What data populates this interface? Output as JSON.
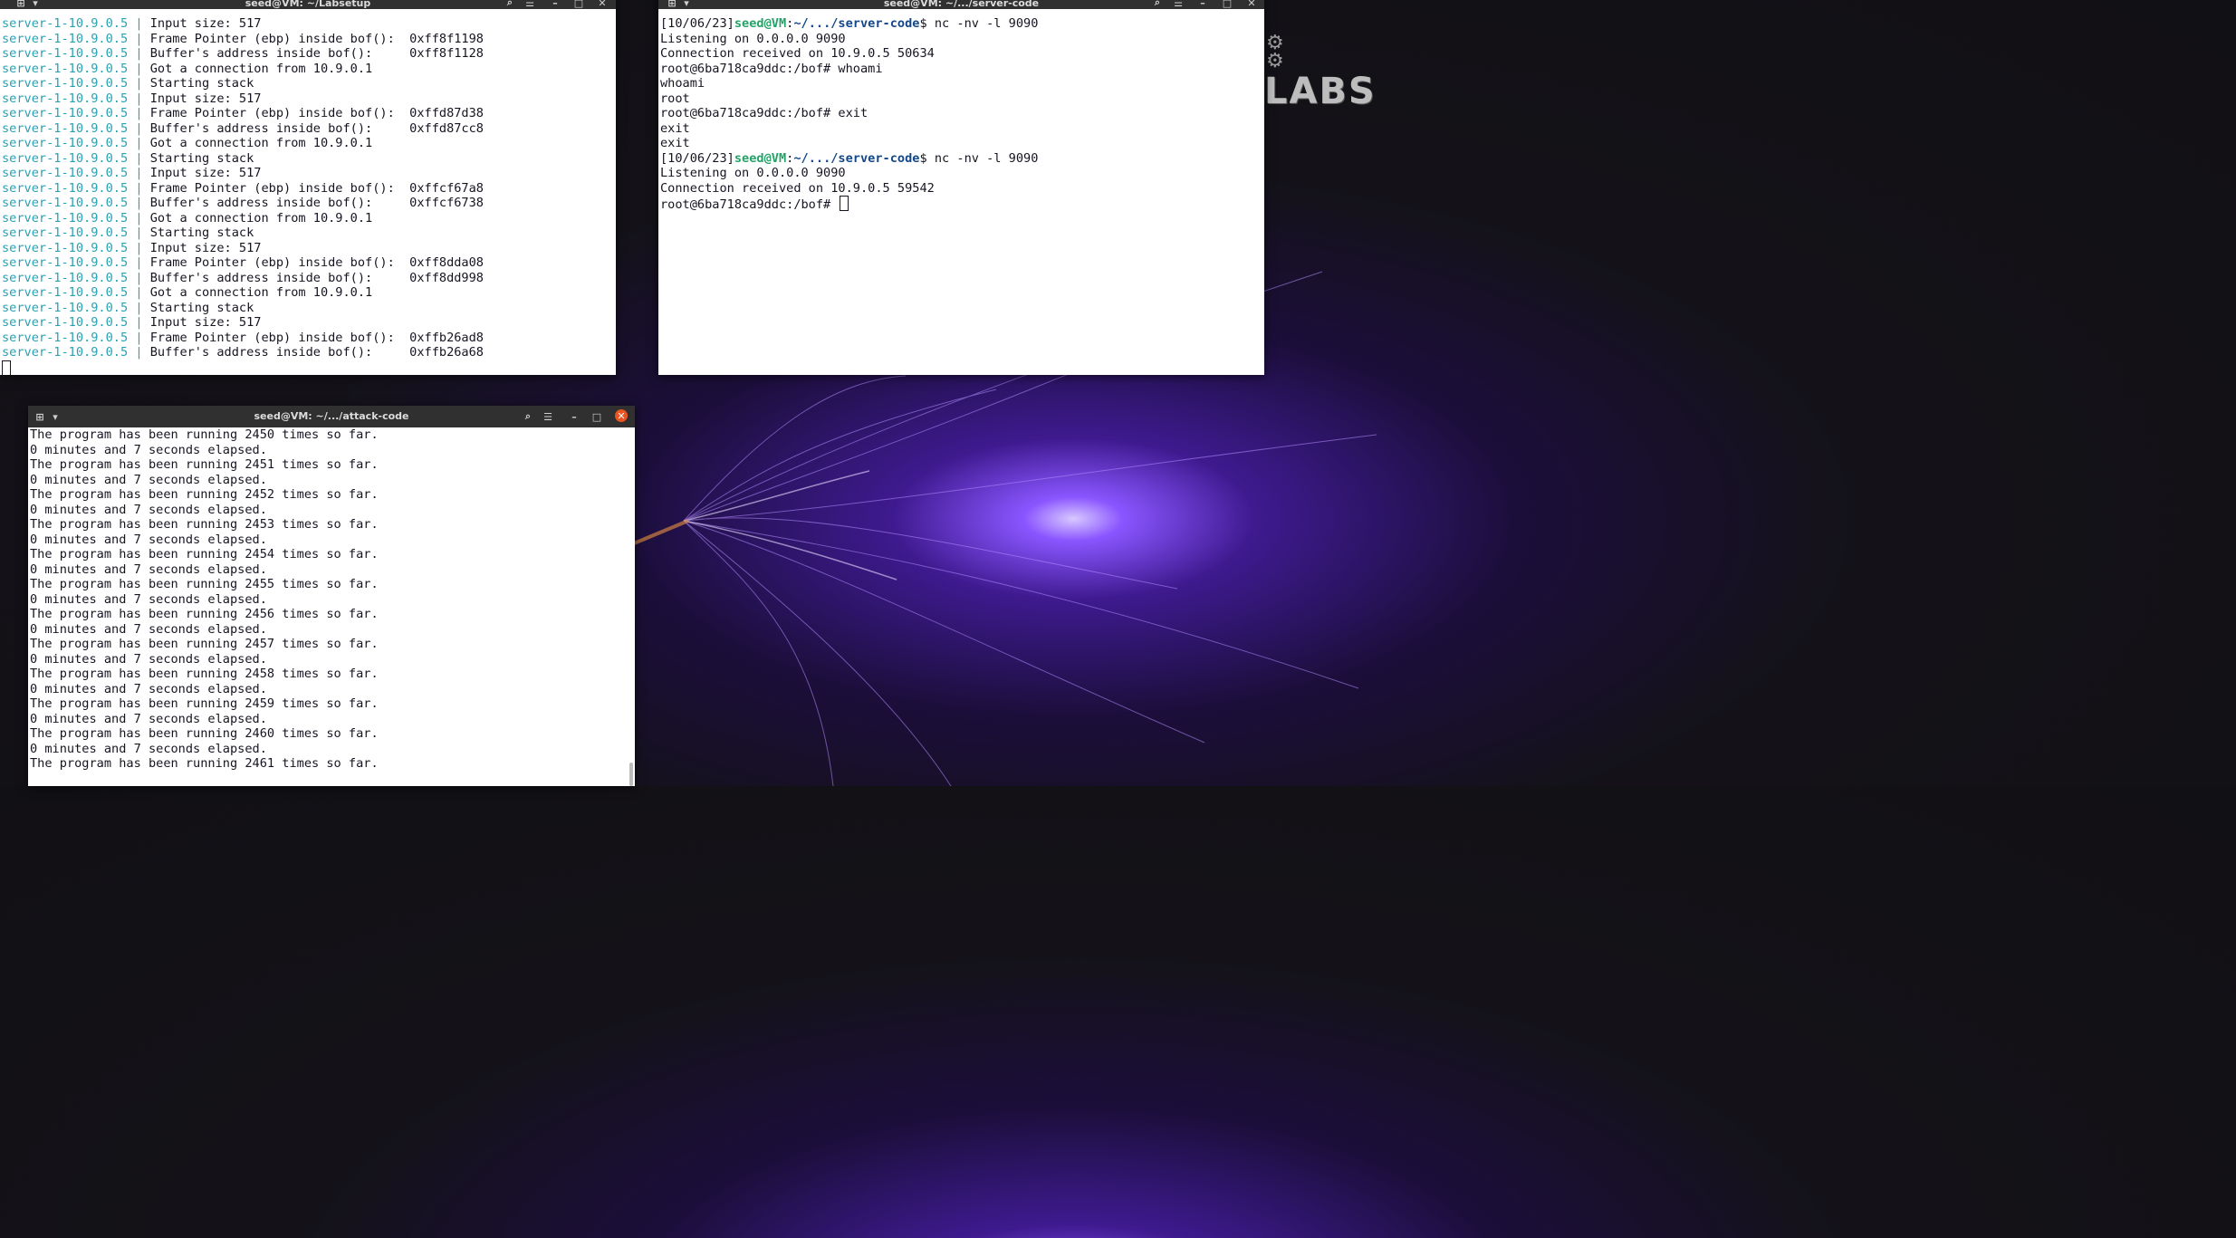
{
  "desktop": {
    "logo_text": "LABS"
  },
  "win_labsetup": {
    "title": "seed@VM: ~/Labsetup",
    "prefix": "server-1-10.9.0.5",
    "sep": " | ",
    "lines": [
      "Input size: 517",
      "Frame Pointer (ebp) inside bof():  0xff8f1198",
      "Buffer's address inside bof():     0xff8f1128",
      "Got a connection from 10.9.0.1",
      "Starting stack",
      "Input size: 517",
      "Frame Pointer (ebp) inside bof():  0xffd87d38",
      "Buffer's address inside bof():     0xffd87cc8",
      "Got a connection from 10.9.0.1",
      "Starting stack",
      "Input size: 517",
      "Frame Pointer (ebp) inside bof():  0xffcf67a8",
      "Buffer's address inside bof():     0xffcf6738",
      "Got a connection from 10.9.0.1",
      "Starting stack",
      "Input size: 517",
      "Frame Pointer (ebp) inside bof():  0xff8dda08",
      "Buffer's address inside bof():     0xff8dd998",
      "Got a connection from 10.9.0.1",
      "Starting stack",
      "Input size: 517",
      "Frame Pointer (ebp) inside bof():  0xffb26ad8",
      "Buffer's address inside bof():     0xffb26a68"
    ]
  },
  "win_server": {
    "title": "seed@VM: ~/.../server-code",
    "lines": [
      {
        "kind": "prompt",
        "date": "[10/06/23]",
        "user": "seed@VM",
        "colon": ":",
        "path": "~/.../server-code",
        "cmd": "$ nc -nv -l 9090"
      },
      {
        "kind": "text",
        "text": "Listening on 0.0.0.0 9090"
      },
      {
        "kind": "text",
        "text": "Connection received on 10.9.0.5 50634"
      },
      {
        "kind": "text",
        "text": "root@6ba718ca9ddc:/bof# whoami"
      },
      {
        "kind": "text",
        "text": "whoami"
      },
      {
        "kind": "text",
        "text": "root"
      },
      {
        "kind": "text",
        "text": "root@6ba718ca9ddc:/bof# exit"
      },
      {
        "kind": "text",
        "text": "exit"
      },
      {
        "kind": "text",
        "text": "exit"
      },
      {
        "kind": "prompt",
        "date": "[10/06/23]",
        "user": "seed@VM",
        "colon": ":",
        "path": "~/.../server-code",
        "cmd": "$ nc -nv -l 9090"
      },
      {
        "kind": "text",
        "text": "Listening on 0.0.0.0 9090"
      },
      {
        "kind": "text",
        "text": "Connection received on 10.9.0.5 59542"
      },
      {
        "kind": "cursor",
        "text": "root@6ba718ca9ddc:/bof# "
      }
    ]
  },
  "win_attack": {
    "title": "seed@VM: ~/.../attack-code",
    "lines": [
      "The program has been running 2450 times so far.",
      "0 minutes and 7 seconds elapsed.",
      "The program has been running 2451 times so far.",
      "0 minutes and 7 seconds elapsed.",
      "The program has been running 2452 times so far.",
      "0 minutes and 7 seconds elapsed.",
      "The program has been running 2453 times so far.",
      "0 minutes and 7 seconds elapsed.",
      "The program has been running 2454 times so far.",
      "0 minutes and 7 seconds elapsed.",
      "The program has been running 2455 times so far.",
      "0 minutes and 7 seconds elapsed.",
      "The program has been running 2456 times so far.",
      "0 minutes and 7 seconds elapsed.",
      "The program has been running 2457 times so far.",
      "0 minutes and 7 seconds elapsed.",
      "The program has been running 2458 times so far.",
      "0 minutes and 7 seconds elapsed.",
      "The program has been running 2459 times so far.",
      "0 minutes and 7 seconds elapsed.",
      "The program has been running 2460 times so far.",
      "0 minutes and 7 seconds elapsed.",
      "The program has been running 2461 times so far."
    ]
  },
  "icons": {
    "new_tab": "new-tab-icon",
    "dropdown": "chevron-down-icon",
    "search": "search-icon",
    "menu": "hamburger-menu-icon",
    "minimize": "minimize-icon",
    "maximize": "maximize-icon",
    "close": "close-icon"
  },
  "colors": {
    "accent_close": "#e95420",
    "prompt_user": "#26a269",
    "prompt_path": "#12488b",
    "container_prefix": "#2aa1b3"
  }
}
